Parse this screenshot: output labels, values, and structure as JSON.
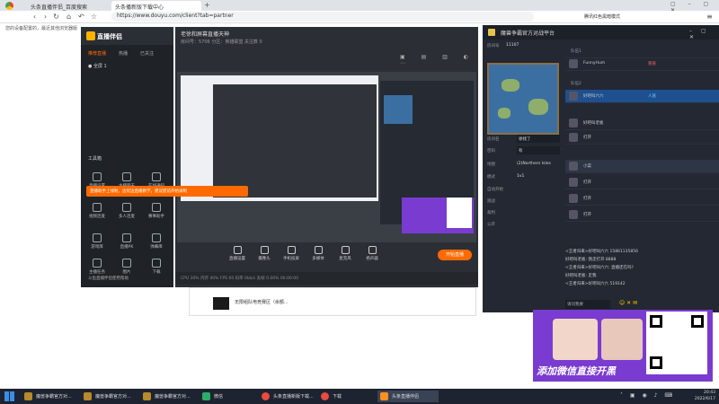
{
  "browser": {
    "tabs": [
      {
        "label": "头条直播伴侣_百度搜索",
        "active": false
      },
      {
        "label": "头条播新版下载中心",
        "active": true
      }
    ],
    "url": "https://www.douyu.com/client?tab=partner",
    "bookmark_text": "腾讯红色黑暗模式",
    "page_left_text": "您的设备配置的，最近其他浏览器版"
  },
  "companion": {
    "title": "直播伴侣",
    "tabs": [
      "推荐直播",
      "热播",
      "已关注"
    ],
    "scene": "全屏 1",
    "tools_title": "工具箱",
    "tools": [
      "直播设置",
      "主播聊天",
      "在线通知",
      "视频连麦",
      "多人连麦",
      "赛事助手",
      "游戏库",
      "直播PK",
      "弹幕库",
      "主播任务",
      "图片",
      "下载"
    ],
    "footer": "斗鱼直播伴侣使用帮助"
  },
  "notice": "直播助手上线啦，边玩边直播教学，建议提前开始录制",
  "live": {
    "title": "老徐和屏幕直播天神",
    "subtitle": "房间号：5706  分区：英雄联盟  关注数 0",
    "controls": [
      "直播设置",
      "摄像头",
      "手机投屏",
      "多媒体",
      "麦克风",
      "扬声器"
    ],
    "start_label": "开始直播",
    "status": "CPU 30%  内存 40%  FPS 60  码率 0kb/s  丢帧 0.00%  00:00:00"
  },
  "room_card": {
    "title": "无限组队电竞赛区（余额..."
  },
  "game": {
    "title": "魔兽争霸官方对战平台",
    "room_no_label": "房间号",
    "room_no": "11107",
    "fields": [
      {
        "label": "房间名",
        "value": "徐找了"
      },
      {
        "label": "密码",
        "value": "有"
      },
      {
        "label": "地图",
        "value": "(2)Northern Isles"
      },
      {
        "label": "模式",
        "value": "1v1"
      }
    ],
    "checks": [
      "自动开始",
      "观战",
      "裁判",
      "公开"
    ],
    "slots": [
      {
        "team": "队伍1",
        "name": "FunnyHum",
        "race": "兽族"
      },
      {
        "team": "队伍2",
        "name": "好吧叫六六",
        "race": "人族"
      },
      {
        "team": "",
        "name": "好吧叫老板",
        "race": ""
      },
      {
        "team": "",
        "name": "打开",
        "race": ""
      },
      {
        "team": "",
        "name": "小菜",
        "race": ""
      },
      {
        "team": "",
        "name": "打开",
        "race": ""
      },
      {
        "team": "",
        "name": "打开",
        "race": ""
      },
      {
        "team": "",
        "name": "打开",
        "race": ""
      }
    ],
    "chat": [
      "<王者归来>好吧叫六六 15861135856",
      "好吧叫老板: 我走打开 8888",
      "<王者归来>好吧叫六六: 直播还在吗?",
      "好吧叫老板: 走我",
      "<王者归来>好吧叫六六 519142"
    ],
    "chat_input_placeholder": "请问我要"
  },
  "ad": {
    "text": "添加微信直接开黑"
  },
  "taskbar": {
    "items": [
      {
        "label": "魔兽争霸官方对..."
      },
      {
        "label": "魔兽争霸官方对..."
      },
      {
        "label": "魔兽争霸官方对..."
      },
      {
        "label": "微信"
      },
      {
        "label": "头条直播新版下载..."
      },
      {
        "label": "下载"
      },
      {
        "label": "头条直播伴侣"
      }
    ],
    "time": "20:43",
    "date": "2022/6/17"
  },
  "colors": {
    "accent": "#ff6a00",
    "panel": "#2b2f35",
    "ad": "#7a3bd0"
  }
}
